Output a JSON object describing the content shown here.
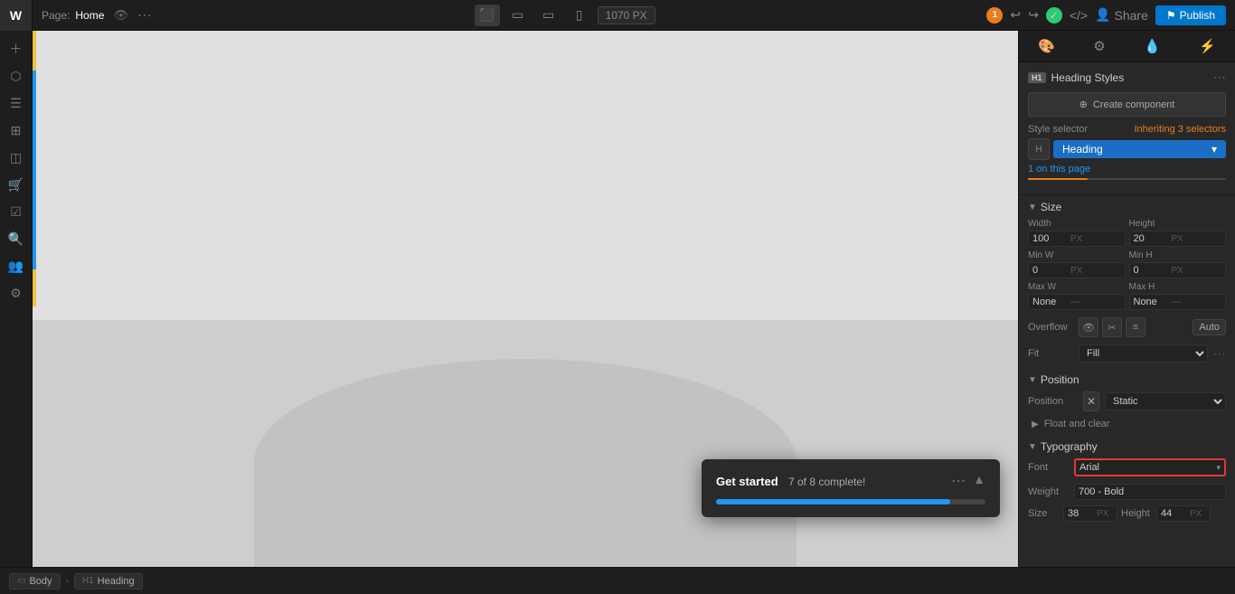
{
  "topbar": {
    "logo": "W",
    "page_label": "Page:",
    "page_name": "Home",
    "viewport": "1070",
    "viewport_unit": "PX",
    "publish_label": "Publish",
    "share_label": "Share",
    "notification_count": "1"
  },
  "devices": [
    {
      "icon": "🖥",
      "active": true
    },
    {
      "icon": "🖥",
      "active": false
    },
    {
      "icon": "🖥",
      "active": false
    },
    {
      "icon": "📱",
      "active": false
    }
  ],
  "panel": {
    "heading_badge": "H1",
    "heading_title": "Heading Styles",
    "create_component": "Create component",
    "style_selector_label": "Style selector",
    "inheriting_label": "Inheriting",
    "selectors_count": "3 selectors",
    "selector_name": "Heading",
    "on_this_page": "1 on this page",
    "size_section": "Size",
    "position_section": "Position",
    "typography_section": "Typography",
    "width_label": "Width",
    "width_value": "100",
    "width_unit": "PX",
    "height_label": "Height",
    "height_value": "20",
    "height_unit": "PX",
    "min_w_label": "Min W",
    "min_w_value": "0",
    "min_w_unit": "PX",
    "min_h_label": "Min H",
    "min_h_value": "0",
    "min_h_unit": "PX",
    "max_w_label": "Max W",
    "max_w_value": "None",
    "max_w_dash": "—",
    "max_h_label": "Max H",
    "max_h_value": "None",
    "max_h_dash": "—",
    "overflow_label": "Overflow",
    "overflow_auto": "Auto",
    "fit_label": "Fit",
    "fit_value": "Fill",
    "position_label": "Position",
    "position_value": "Static",
    "float_label": "Float and clear",
    "font_label": "Font",
    "font_value": "Arial",
    "weight_label": "Weight",
    "weight_value": "700 - Bold",
    "size_label": "Size",
    "size_value": "38",
    "size_unit": "PX",
    "height_typo_label": "Height",
    "height_typo_value": "44"
  },
  "popup": {
    "title": "Get started",
    "progress_text": "7 of 8 complete!",
    "progress_percent": 87
  },
  "breadcrumb": {
    "body_label": "Body",
    "heading_label": "Heading"
  }
}
